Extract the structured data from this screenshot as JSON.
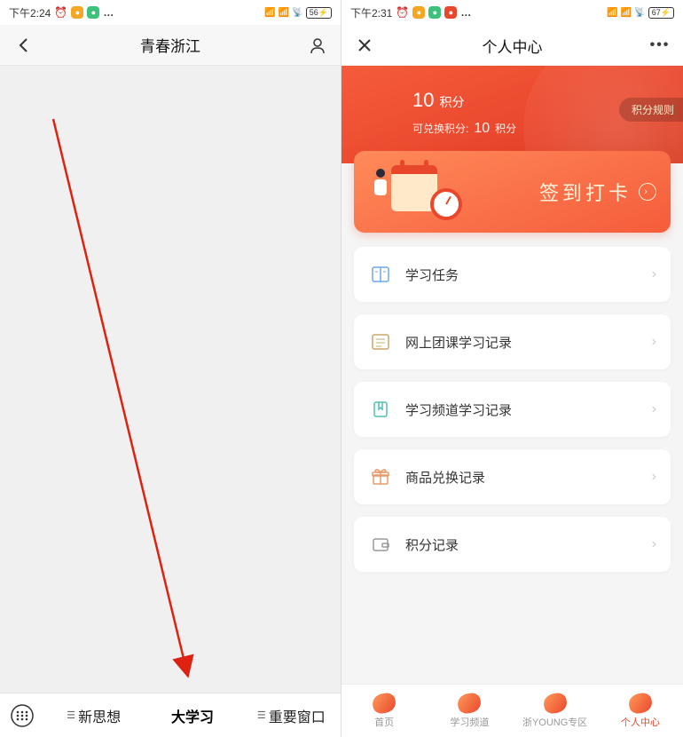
{
  "phone1": {
    "status": {
      "time": "下午2:24",
      "battery": "56",
      "alarm_icon": "⏰"
    },
    "navbar": {
      "title": "青春浙江"
    },
    "tabs": [
      {
        "label": "新思想"
      },
      {
        "label": "大学习"
      },
      {
        "label": "重要窗口"
      }
    ]
  },
  "phone2": {
    "status": {
      "time": "下午2:31",
      "battery": "67",
      "alarm_icon": "⏰"
    },
    "navbar": {
      "title": "个人中心",
      "more": "•••"
    },
    "hero": {
      "points_value": "10",
      "points_unit": "积分",
      "exchange_label": "可兑换积分:",
      "exchange_value": "10",
      "rules_label": "积分规则"
    },
    "checkin": {
      "label": "签到打卡"
    },
    "menu": [
      {
        "label": "学习任务",
        "icon": "book"
      },
      {
        "label": "网上团课学习记录",
        "icon": "news"
      },
      {
        "label": "学习频道学习记录",
        "icon": "bookmark"
      },
      {
        "label": "商品兑换记录",
        "icon": "gift"
      },
      {
        "label": "积分记录",
        "icon": "wallet"
      }
    ],
    "tabs": [
      {
        "label": "首页"
      },
      {
        "label": "学习频道"
      },
      {
        "label": "浙YOUNG专区"
      },
      {
        "label": "个人中心"
      }
    ]
  }
}
